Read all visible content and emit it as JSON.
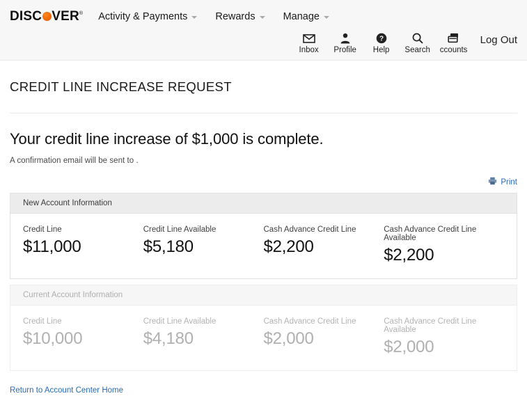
{
  "brand": {
    "logo_before": "DISC",
    "logo_ball": "orange-ball-icon",
    "logo_after": "VER",
    "logo_reg": "®"
  },
  "header": {
    "nav": [
      {
        "label": "Activity & Payments",
        "caret": true
      },
      {
        "label": "Rewards",
        "caret": true
      },
      {
        "label": "Manage",
        "caret": true
      }
    ],
    "utility": [
      {
        "label": "Inbox",
        "icon": "envelope-icon"
      },
      {
        "label": "Profile",
        "icon": "person-icon"
      },
      {
        "label": "Help",
        "icon": "question-circle-icon"
      },
      {
        "label": "Search",
        "icon": "search-icon"
      },
      {
        "label": "ccounts",
        "icon": "card-stack-icon"
      }
    ],
    "logout_label": "Log Out"
  },
  "page": {
    "title": "CREDIT LINE INCREASE REQUEST",
    "headline": "Your credit line increase of $1,000 is complete.",
    "confirmation_prefix": "A confirmation email will be sent to",
    "confirmation_email": "",
    "print_label": "Print",
    "print_icon": "printer-icon",
    "footer_link": "Return to Account Center Home"
  },
  "panels": [
    {
      "heading": "New Account Information",
      "dim": false,
      "cells": [
        {
          "label": "Credit Line",
          "value": "$11,000"
        },
        {
          "label": "Credit Line Available",
          "value": "$5,180"
        },
        {
          "label": "Cash Advance Credit Line",
          "value": "$2,200"
        },
        {
          "label": "Cash Advance Credit Line Available",
          "value": "$2,200"
        }
      ]
    },
    {
      "heading": "Current Account Information",
      "dim": true,
      "cells": [
        {
          "label": "Credit Line",
          "value": "$10,000"
        },
        {
          "label": "Credit Line Available",
          "value": "$4,180"
        },
        {
          "label": "Cash Advance Credit Line",
          "value": "$2,000"
        },
        {
          "label": "Cash Advance Credit Line Available",
          "value": "$2,000"
        }
      ]
    }
  ],
  "colors": {
    "brand_orange": "#f26a0a",
    "link_blue": "#2b6cb3",
    "header_bg": "#f7f7f7",
    "panel_head_bg": "#ececec",
    "dim_text": "#b0b0b0"
  }
}
